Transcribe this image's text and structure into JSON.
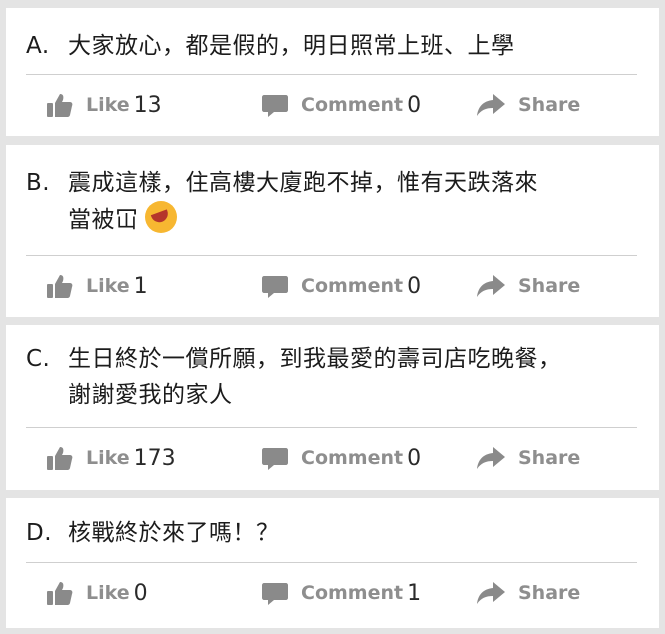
{
  "posts": [
    {
      "letter": "A.",
      "line1": "大家放心，都是假的，明日照常上班、上學",
      "line2": "",
      "has_emoji": false,
      "like_label": "Like",
      "like_count": "13",
      "comment_label": "Comment",
      "comment_count": "0",
      "share_label": "Share"
    },
    {
      "letter": "B.",
      "line1": "震成這樣，住高樓大廈跑不掉，惟有天跌落來",
      "line2": "當被冚",
      "has_emoji": true,
      "emoji_icon": "rolling-on-floor-laughing-icon",
      "like_label": "Like",
      "like_count": "1",
      "comment_label": "Comment",
      "comment_count": "0",
      "share_label": "Share"
    },
    {
      "letter": "C.",
      "line1": "生日終於一償所願，到我最愛的壽司店吃晚餐，",
      "line2": "謝謝愛我的家人",
      "has_emoji": false,
      "like_label": "Like",
      "like_count": "173",
      "comment_label": "Comment",
      "comment_count": "0",
      "share_label": "Share"
    },
    {
      "letter": "D.",
      "line1": "核戰終於來了嗎！？",
      "line2": "",
      "has_emoji": false,
      "like_label": "Like",
      "like_count": "0",
      "comment_label": "Comment",
      "comment_count": "1",
      "share_label": "Share"
    }
  ],
  "icons": {
    "like": "thumbs-up-icon",
    "comment": "speech-bubble-icon",
    "share": "share-arrow-icon"
  },
  "colors": {
    "icon": "#8a8a8a",
    "background": "#e4e4e4",
    "card": "#ffffff"
  }
}
